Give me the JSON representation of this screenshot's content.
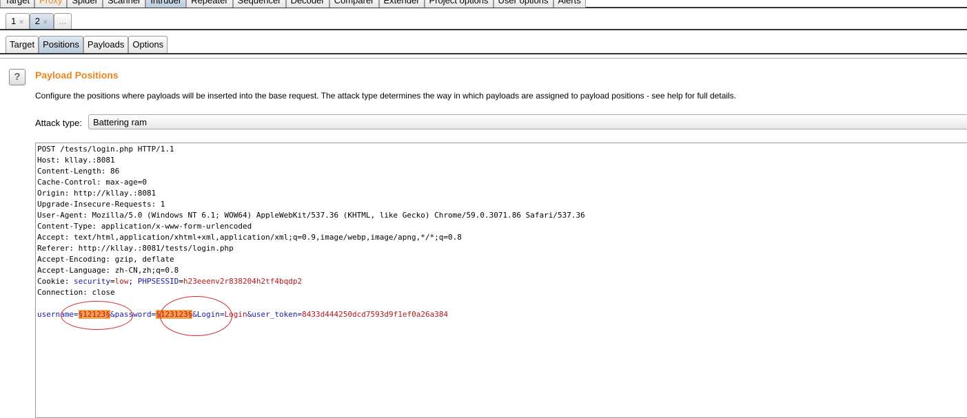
{
  "top_tabs": [
    "Target",
    "Proxy",
    "Spider",
    "Scanner",
    "Intruder",
    "Repeater",
    "Sequencer",
    "Decoder",
    "Comparer",
    "Extender",
    "Project options",
    "User options",
    "Alerts"
  ],
  "attack_tabs": [
    "1",
    "2",
    "..."
  ],
  "sub_tabs": [
    "Target",
    "Positions",
    "Payloads",
    "Options"
  ],
  "panel": {
    "title": "Payload Positions",
    "description": "Configure the positions where payloads will be inserted into the base request. The attack type determines the way in which payloads are assigned to payload positions - see help for full details.",
    "attack_type_label": "Attack type:",
    "attack_type_value": "Battering ram"
  },
  "request": {
    "lines": [
      "POST /tests/login.php HTTP/1.1",
      "Host: kllay.:8081",
      "Content-Length: 86",
      "Cache-Control: max-age=0",
      "Origin: http://kllay.:8081",
      "Upgrade-Insecure-Requests: 1",
      "User-Agent: Mozilla/5.0 (Windows NT 6.1; WOW64) AppleWebKit/537.36 (KHTML, like Gecko) Chrome/59.0.3071.86 Safari/537.36",
      "Content-Type: application/x-www-form-urlencoded",
      "Accept: text/html,application/xhtml+xml,application/xml;q=0.9,image/webp,image/apng,*/*;q=0.8",
      "Referer: http://kllay.:8081/tests/login.php",
      "Accept-Encoding: gzip, deflate",
      "Accept-Language: zh-CN,zh;q=0.8"
    ],
    "cookie": {
      "label": "Cookie: ",
      "k1": "security",
      "v1": "low",
      "sep": "; ",
      "k2": "PHPSESSID",
      "v2": "h23eeenv2r838204h2tf4bqdp2"
    },
    "connection": "Connection: close",
    "body": {
      "k1": "username",
      "m1": "§12123§",
      "k2": "&password",
      "m2": "§123123§",
      "k3": "&Login",
      "v3": "Login",
      "k4": "&user_token",
      "v4": "8433d444250dcd7593d9f1ef0a26a384"
    }
  },
  "colors": {
    "accent": "#e8851c",
    "marker": "#f5a04a",
    "annotation_circle": "#d22222"
  }
}
